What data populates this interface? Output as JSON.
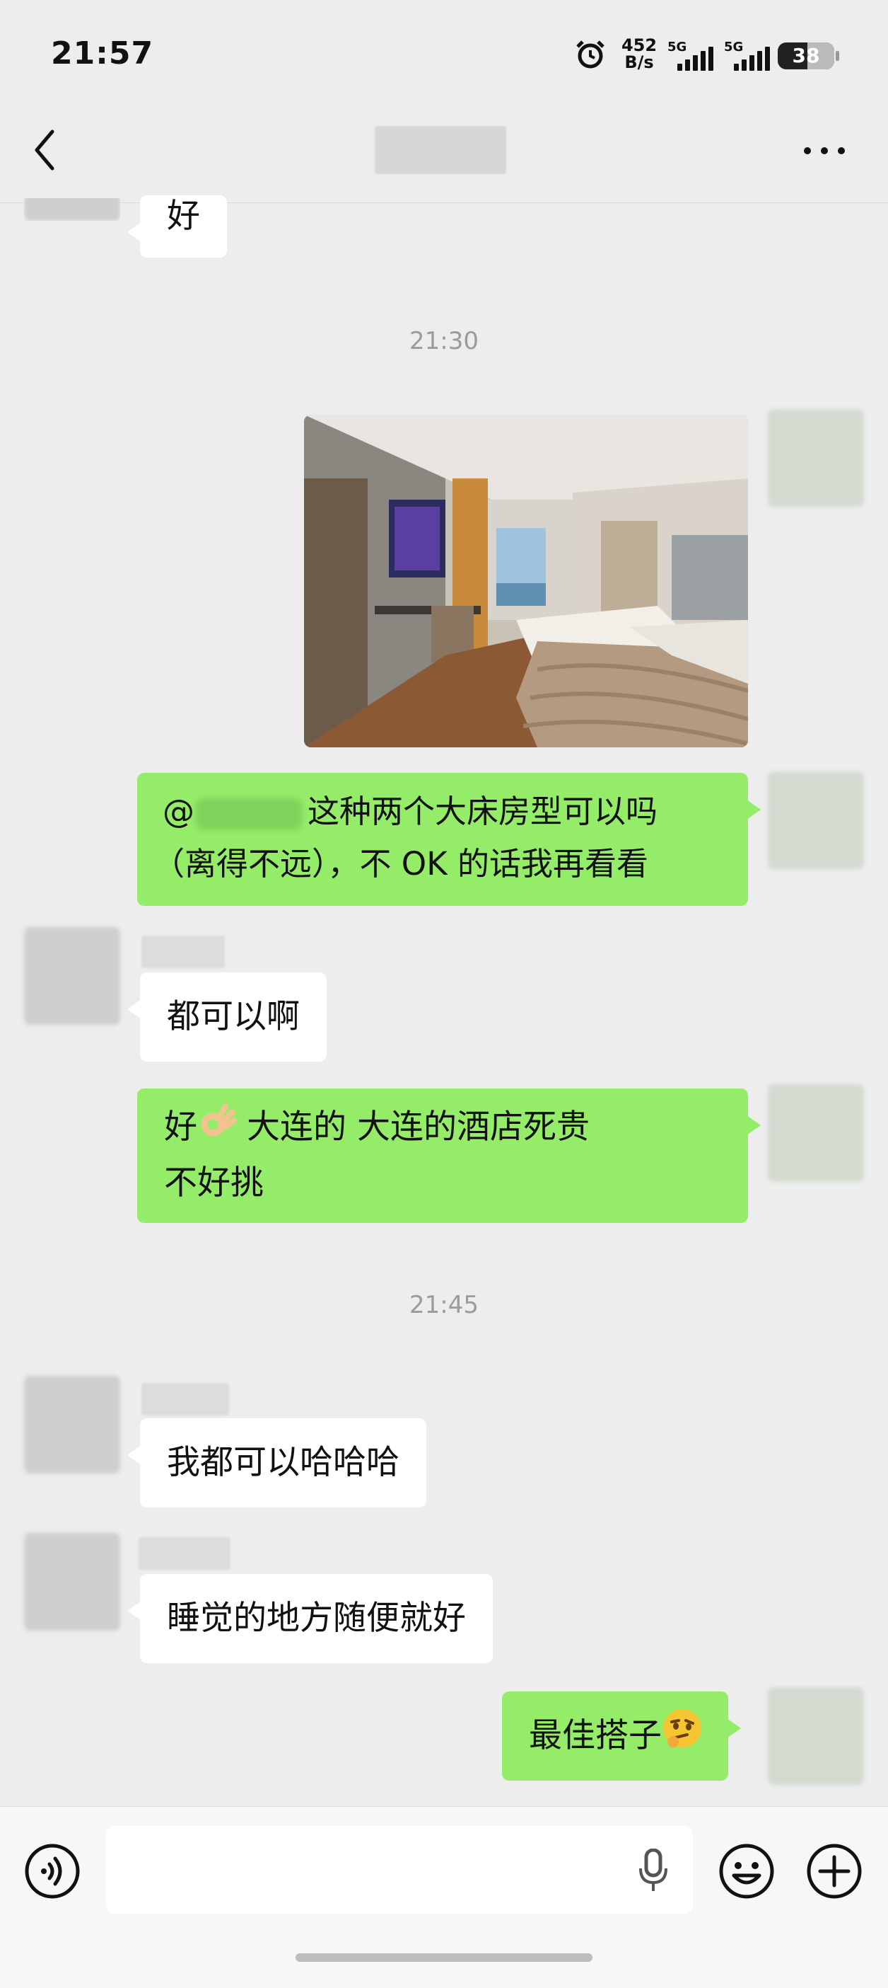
{
  "status_bar": {
    "time": "21:57",
    "net_speed_value": "452",
    "net_speed_unit": "B/s",
    "signal1_label": "5G",
    "signal2_label": "5G",
    "battery": "38"
  },
  "header": {
    "back_icon": "chevron-left-icon",
    "more_icon": "more-dots-icon"
  },
  "messages": {
    "m1": {
      "side": "received",
      "text": "好"
    },
    "ts1": "21:30",
    "m2": {
      "side": "sent",
      "type": "image",
      "description_icon": "hotel-room-photo"
    },
    "m3": {
      "side": "sent",
      "prefix": "@",
      "line1": "这种两个大床房型可以吗",
      "line2": "（离得不远），不 OK 的话我再看看"
    },
    "m4": {
      "side": "received",
      "text": "都可以啊"
    },
    "m5": {
      "side": "sent",
      "line1_a": "好",
      "line1_b": "大连的   大连的酒店死贵",
      "line2": "不好挑",
      "emoji_icon": "ok-hand-emoji"
    },
    "ts2": "21:45",
    "m6": {
      "side": "received",
      "text": "我都可以哈哈哈"
    },
    "m7": {
      "side": "received",
      "text": "睡觉的地方随便就好"
    },
    "m8": {
      "side": "sent",
      "text": "最佳搭子",
      "emoji_icon": "thinking-face-emoji"
    }
  },
  "input_bar": {
    "voice_icon": "voice-icon",
    "mic_icon": "mic-icon",
    "emoji_icon": "smiley-icon",
    "plus_icon": "plus-icon"
  },
  "colors": {
    "sent_bubble": "#95ec69",
    "received_bubble": "#ffffff",
    "background": "#ededed"
  }
}
